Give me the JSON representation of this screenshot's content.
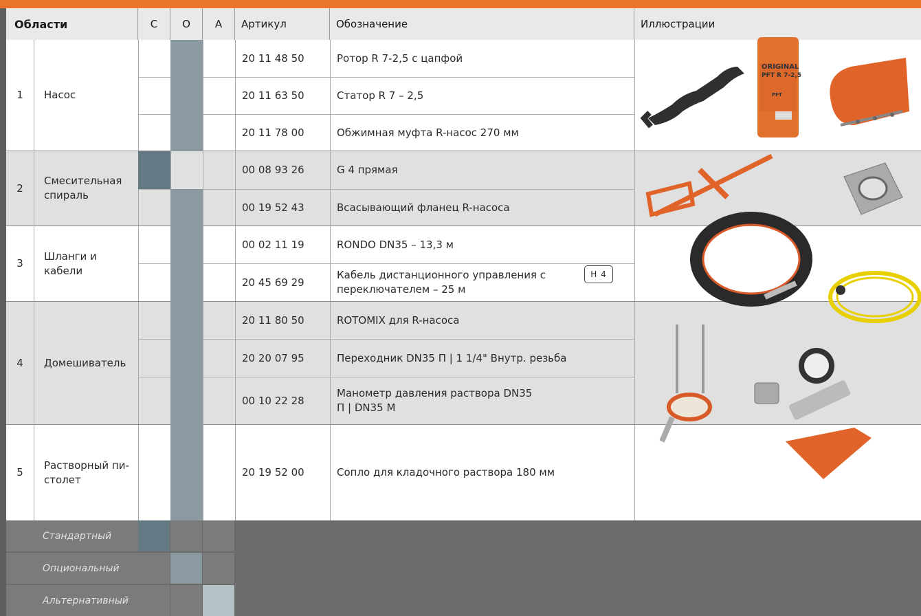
{
  "header": {
    "areas": "Области",
    "c": "С",
    "o": "О",
    "a": "А",
    "article": "Артикул",
    "designation": "Обозначение",
    "illustrations": "Иллюстрации"
  },
  "sections": [
    {
      "num": "1",
      "name": "Насос"
    },
    {
      "num": "2",
      "name": "Смесительная спираль"
    },
    {
      "num": "3",
      "name": "Шланги и кабели"
    },
    {
      "num": "4",
      "name": "Домешиватель"
    },
    {
      "num": "5",
      "name": "Растворный пи-столет"
    }
  ],
  "rows": [
    {
      "article": "20 11 48 50",
      "designation": "Ротор R 7-2,5 с цапфой",
      "category": "optional"
    },
    {
      "article": "20 11 63 50",
      "designation": "Статор R 7 – 2,5",
      "category": "optional"
    },
    {
      "article": "20 11 78 00",
      "designation": "Обжимная муфта R-насос 270 мм",
      "category": "optional"
    },
    {
      "article": "00 08 93 26",
      "designation": "G 4 прямая",
      "category": "standard"
    },
    {
      "article": "00 19 52 43",
      "designation": "Всасывающий фланец R-насоса",
      "category": "optional"
    },
    {
      "article": "00 02 11 19",
      "designation": "RONDO DN35 – 13,3 м",
      "category": "optional"
    },
    {
      "article": "20 45 69 29",
      "designation": "Кабель дистанционного управления с переключателем – 25 м",
      "badge": "H 4",
      "category": "optional"
    },
    {
      "article": "20 11 80 50",
      "designation": "ROTOMIX для R-насоса",
      "category": "optional"
    },
    {
      "article": "20 20 07 95",
      "designation": "Переходник DN35 П | 1 1/4\" Внутр. резьба",
      "category": "optional"
    },
    {
      "article": "00 10 22 28",
      "designation": "Манометр давления раствора DN35 П | DN35 М",
      "category": "optional"
    },
    {
      "article": "20 19 52 00",
      "designation": "Сопло для кладочного раствора 180 мм",
      "category": "optional"
    }
  ],
  "legend": [
    {
      "label": "Стандартный",
      "color": "#647983"
    },
    {
      "label": "Опциональный",
      "color": "#8b9aa1"
    },
    {
      "label": "Альтернативный",
      "color": "#b6c1c6"
    }
  ],
  "illustrations": {
    "stator_label_1": "ORIGINAL",
    "stator_label_2": "PFT R 7-2,5",
    "stator_label_3": "PFT"
  },
  "colors": {
    "accent": "#e8752a",
    "standard": "#647983",
    "optional": "#8b9aa1",
    "alternative": "#b6c1c6"
  }
}
